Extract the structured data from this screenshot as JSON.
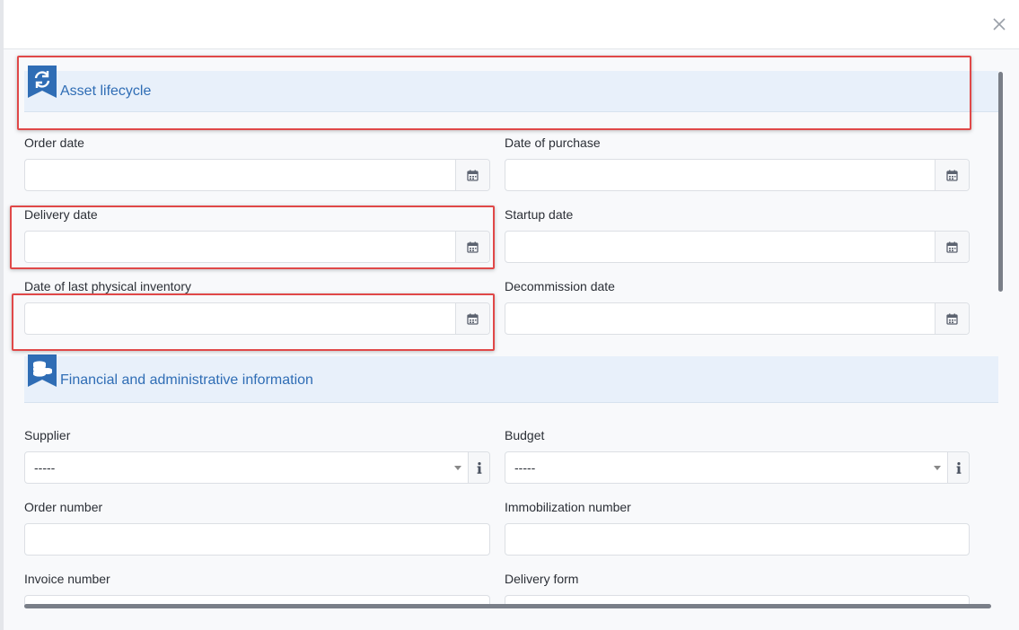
{
  "sections": {
    "lifecycle": {
      "title": "Asset lifecycle",
      "icon": "refresh-bookmark-icon"
    },
    "financial": {
      "title": "Financial and administrative information",
      "icon": "coins-bookmark-icon"
    }
  },
  "fields": {
    "order_date": {
      "label": "Order date",
      "value": ""
    },
    "date_of_purchase": {
      "label": "Date of purchase",
      "value": ""
    },
    "delivery_date": {
      "label": "Delivery date",
      "value": ""
    },
    "startup_date": {
      "label": "Startup date",
      "value": ""
    },
    "last_inventory_date": {
      "label": "Date of last physical inventory",
      "value": ""
    },
    "decommission_date": {
      "label": "Decommission date",
      "value": ""
    },
    "supplier": {
      "label": "Supplier",
      "selected": "-----"
    },
    "budget": {
      "label": "Budget",
      "selected": "-----"
    },
    "order_number": {
      "label": "Order number",
      "value": ""
    },
    "immobilization_number": {
      "label": "Immobilization number",
      "value": ""
    },
    "invoice_number": {
      "label": "Invoice number",
      "value": ""
    },
    "delivery_form": {
      "label": "Delivery form",
      "value": ""
    }
  },
  "icons": {
    "calendar": "calendar-icon",
    "info": "info-icon",
    "close": "close-icon"
  },
  "colors": {
    "accent": "#2f6db5",
    "section_bg": "#e8f0fa",
    "highlight": "#e04848"
  }
}
